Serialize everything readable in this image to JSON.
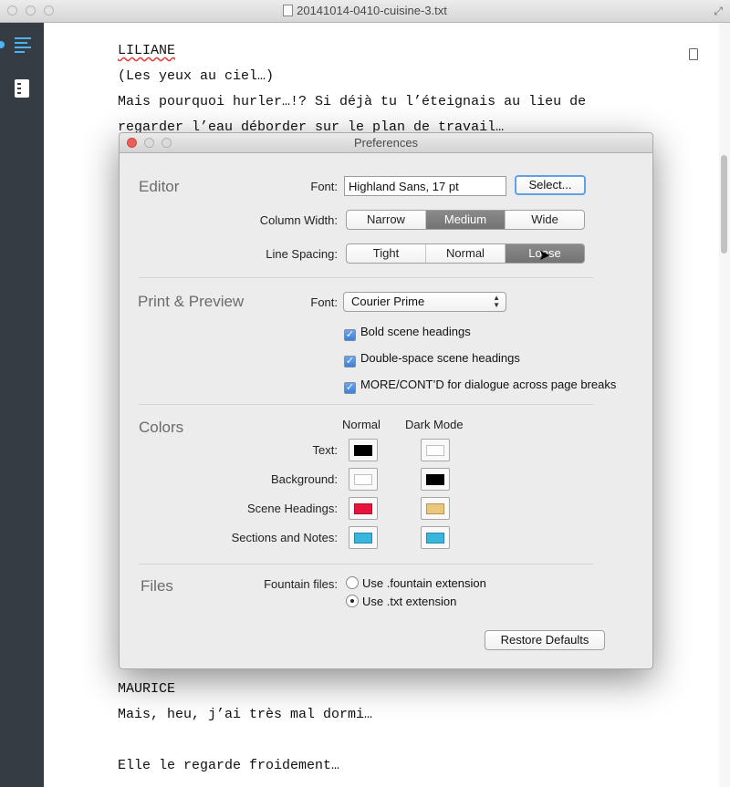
{
  "window": {
    "title": "20141014-0410-cuisine-3.txt"
  },
  "editor": {
    "lines": [
      "LILIANE",
      "(Les yeux au ciel…)",
      "Mais pourquoi hurler…!? Si déjà tu l’éteignais au lieu de",
      "regarder l’eau déborder sur le plan de travail…",
      "MAURICE",
      "Mais, heu, j’ai très mal dormi…",
      "Elle le regarde froidement…"
    ]
  },
  "preferences": {
    "title": "Preferences",
    "editor": {
      "section": "Editor",
      "font_label": "Font:",
      "font_value": "Highland Sans, 17 pt",
      "select_button": "Select...",
      "column_width_label": "Column Width:",
      "column_width_options": [
        "Narrow",
        "Medium",
        "Wide"
      ],
      "column_width_selected": "Medium",
      "line_spacing_label": "Line Spacing:",
      "line_spacing_options": [
        "Tight",
        "Normal",
        "Loose"
      ],
      "line_spacing_selected": "Loose"
    },
    "print": {
      "section": "Print & Preview",
      "font_label": "Font:",
      "font_value": "Courier Prime",
      "checkboxes": [
        {
          "label": "Bold scene headings",
          "checked": true
        },
        {
          "label": "Double-space scene headings",
          "checked": true
        },
        {
          "label": "MORE/CONT’D for dialogue across page breaks",
          "checked": true
        }
      ]
    },
    "colors": {
      "section": "Colors",
      "col_normal": "Normal",
      "col_dark": "Dark Mode",
      "rows": [
        {
          "label": "Text:",
          "normal": "#000000",
          "dark": "#ffffff"
        },
        {
          "label": "Background:",
          "normal": "#ffffff",
          "dark": "#000000"
        },
        {
          "label": "Scene Headings:",
          "normal": "#e8143c",
          "dark": "#ecc77b"
        },
        {
          "label": "Sections and Notes:",
          "normal": "#39b6dd",
          "dark": "#39b6dd"
        }
      ]
    },
    "files": {
      "section": "Files",
      "label": "Fountain files:",
      "options": [
        "Use .fountain extension",
        "Use .txt extension"
      ],
      "selected": "Use .txt extension"
    },
    "restore_button": "Restore Defaults"
  }
}
